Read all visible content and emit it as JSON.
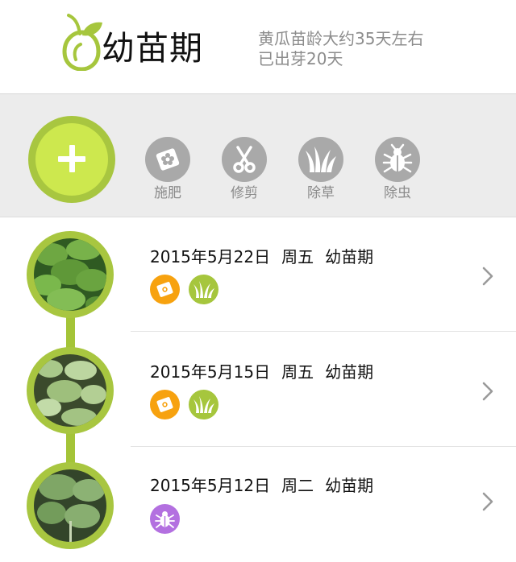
{
  "header": {
    "title": "幼苗期",
    "info_line1": "黄瓜苗龄大约35天左右",
    "info_line2": "已出芽20天"
  },
  "toolbar": {
    "add_icon": "plus-icon",
    "tools": [
      {
        "label": "施肥",
        "icon": "fertilizer-icon"
      },
      {
        "label": "修剪",
        "icon": "scissors-icon"
      },
      {
        "label": "除草",
        "icon": "grass-icon"
      },
      {
        "label": "除虫",
        "icon": "bug-icon"
      }
    ]
  },
  "entries": [
    {
      "date": "2015年5月22日",
      "weekday": "周五",
      "stage": "幼苗期",
      "badges": [
        "fertilizer",
        "grass"
      ]
    },
    {
      "date": "2015年5月15日",
      "weekday": "周五",
      "stage": "幼苗期",
      "badges": [
        "fertilizer",
        "grass"
      ]
    },
    {
      "date": "2015年5月12日",
      "weekday": "周二",
      "stage": "幼苗期",
      "badges": [
        "bug"
      ]
    }
  ],
  "colors": {
    "accent_green": "#a8c640",
    "light_green": "#cde84e",
    "fertilizer_orange": "#f7a20f",
    "grass_green": "#a6c63d",
    "bug_purple": "#b370e0",
    "tool_gray": "#a9a9a9"
  }
}
